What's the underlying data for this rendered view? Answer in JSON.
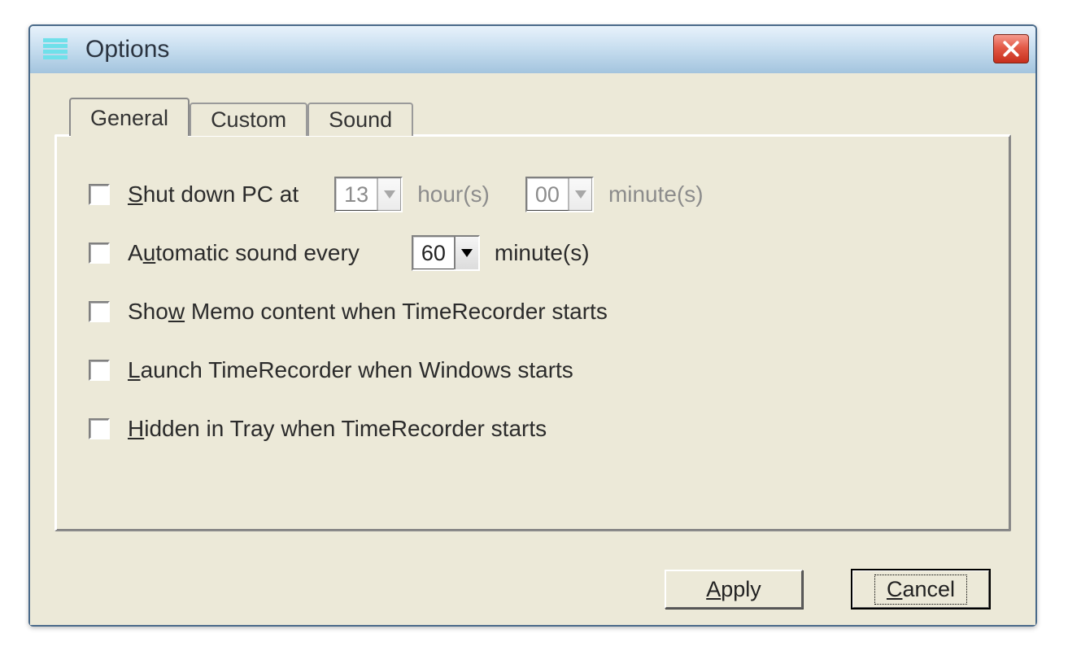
{
  "window": {
    "title": "Options"
  },
  "tabs": {
    "general": "General",
    "custom": "Custom",
    "sound": "Sound"
  },
  "general": {
    "shutdown": {
      "label_pre": "S",
      "label_post": "hut down PC at",
      "hour_value": "13",
      "hour_unit": "hour(s)",
      "minute_value": "00",
      "minute_unit": "minute(s)"
    },
    "autosound": {
      "label_pre": "A",
      "label_mn": "u",
      "label_post": "tomatic sound every",
      "interval_value": "60",
      "interval_unit": "minute(s)"
    },
    "showmemo": {
      "label_pre": "Sho",
      "label_mn": "w",
      "label_post": " Memo content when TimeRecorder starts"
    },
    "launch": {
      "label_mn": "L",
      "label_post": "aunch TimeRecorder when Windows starts"
    },
    "hidden": {
      "label_mn": "H",
      "label_post": "idden in Tray when TimeRecorder starts"
    }
  },
  "buttons": {
    "apply_mn": "A",
    "apply_post": "pply",
    "cancel_mn": "C",
    "cancel_post": "ancel"
  }
}
